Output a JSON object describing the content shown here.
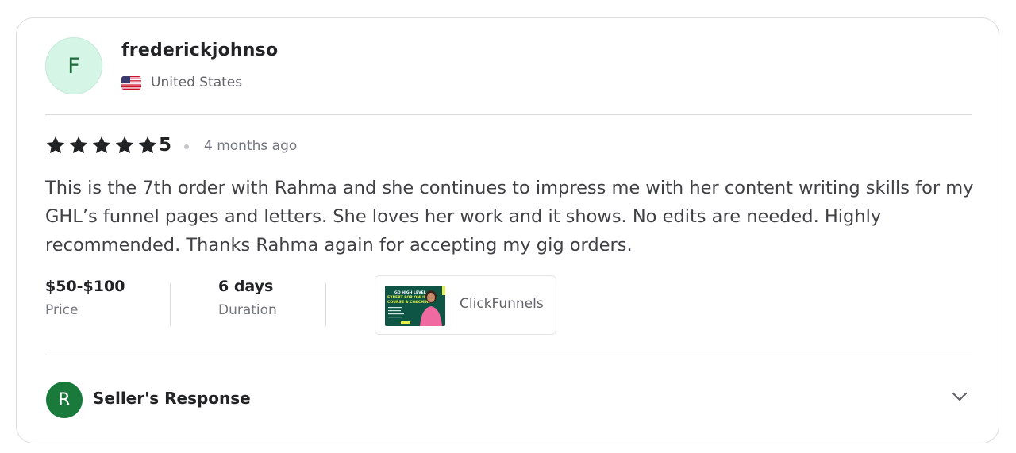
{
  "reviewer": {
    "initial": "F",
    "username": "frederickjohnso",
    "country": "United States",
    "flag_icon": "us-flag-icon"
  },
  "rating": {
    "stars": 5,
    "value": "5",
    "time_ago": "4 months ago",
    "star_color": "#222325"
  },
  "review_text": "This is the 7th order with Rahma and she continues to impress me with her content writing skills for my GHL’s funnel pages and letters. She loves her work and it shows. No edits are needed. Highly recommended. Thanks Rahma again for accepting my gig orders.",
  "stats": {
    "price": {
      "value": "$50-$100",
      "label": "Price"
    },
    "duration": {
      "value": "6 days",
      "label": "Duration"
    }
  },
  "gig": {
    "label": "ClickFunnels",
    "thumbnail_text": [
      "GO HIGH LEVEL",
      "EXPERT FOR ONLINE",
      "COURSE & COACHING"
    ]
  },
  "seller_response": {
    "initial": "R",
    "label": "Seller's Response",
    "toggle_icon": "chevron-down-icon"
  },
  "colors": {
    "avatar_bg": "#d5f5e6",
    "seller_avatar_bg": "#1a7a3c",
    "border": "#dadbdd"
  }
}
